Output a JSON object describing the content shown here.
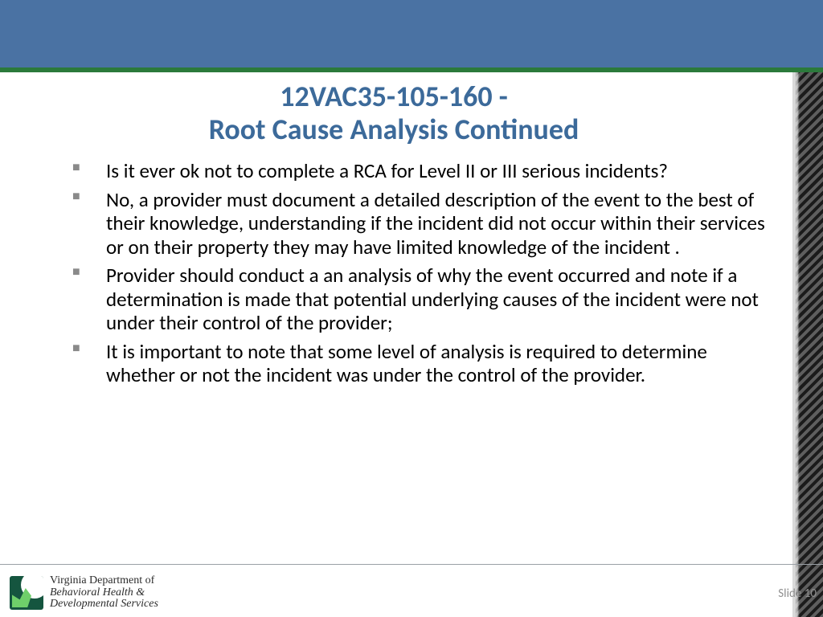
{
  "title": {
    "code": "12VAC35-105-160  -",
    "main": "Root Cause Analysis Continued"
  },
  "bullets": [
    "Is it ever ok not to complete a RCA for Level II or III serious incidents?",
    "No, a provider must document a detailed description of the event to the best of their knowledge, understanding if the incident did not occur within their services or on their property they may have limited knowledge of the incident .",
    "Provider should conduct a an analysis of why the event occurred and note if  a determination is made that potential underlying causes of the incident were not under their control of the provider;",
    "It is important to note that some level of analysis is required to determine whether or not the incident was under the control of the provider."
  ],
  "footer": {
    "org_line1": "Virginia Department of",
    "org_line2": "Behavioral Health &",
    "org_line3": "Developmental Services",
    "slide_label": "Slide 10"
  }
}
